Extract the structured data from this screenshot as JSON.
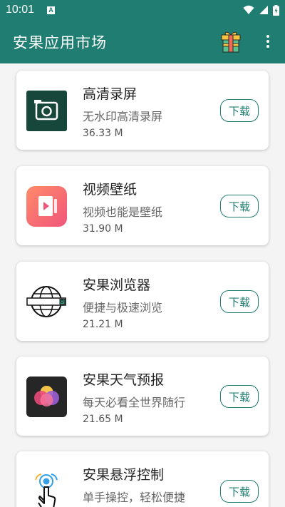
{
  "status_bar": {
    "time": "10:01",
    "notification_icon": "a-icon"
  },
  "app_bar": {
    "title": "安果应用市场"
  },
  "apps": [
    {
      "name": "高清录屏",
      "desc": "无水印高清录屏",
      "size": "36.33 M",
      "button": "下载",
      "icon": "screen-recorder-icon"
    },
    {
      "name": "视频壁纸",
      "desc": "视频也能是壁纸",
      "size": "31.90 M",
      "button": "下载",
      "icon": "video-wallpaper-icon"
    },
    {
      "name": "安果浏览器",
      "desc": "便捷与极速浏览",
      "size": "21.21 M",
      "button": "下载",
      "icon": "browser-icon"
    },
    {
      "name": "安果天气预报",
      "desc": "每天必看全世界随行",
      "size": "21.65 M",
      "button": "下载",
      "icon": "weather-icon"
    },
    {
      "name": "安果悬浮控制",
      "desc": "单手操控，轻松便捷",
      "size": "",
      "button": "下载",
      "icon": "touch-control-icon"
    }
  ]
}
